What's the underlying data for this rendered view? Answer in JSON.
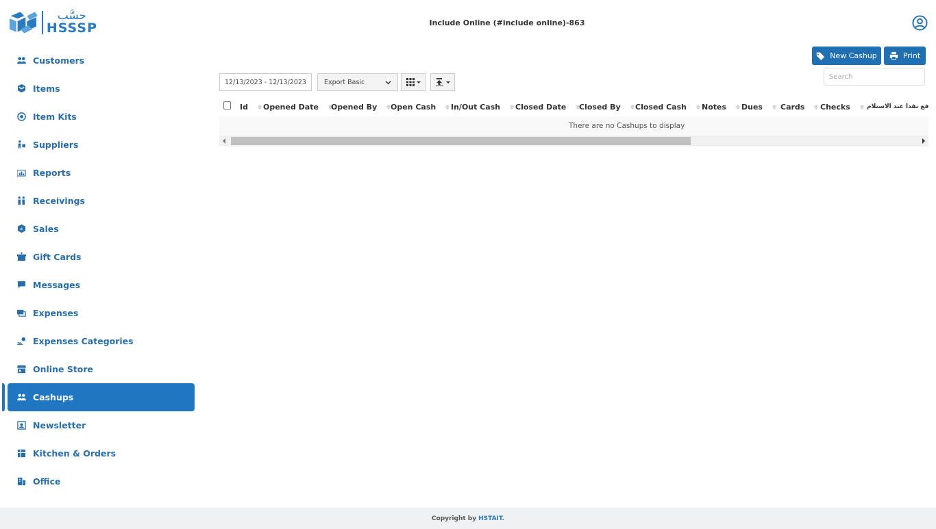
{
  "brand": {
    "arabic": "حسَّب",
    "latin": "HSSSP",
    "color": "#2a7bc0"
  },
  "header": {
    "title": "Include Online (#include online)-863"
  },
  "sidebar": {
    "items": [
      {
        "label": "Customers",
        "icon": "customers-icon"
      },
      {
        "label": "Items",
        "icon": "items-icon"
      },
      {
        "label": "Item Kits",
        "icon": "item-kits-icon"
      },
      {
        "label": "Suppliers",
        "icon": "suppliers-icon"
      },
      {
        "label": "Reports",
        "icon": "reports-icon"
      },
      {
        "label": "Receivings",
        "icon": "receivings-icon"
      },
      {
        "label": "Sales",
        "icon": "sales-icon"
      },
      {
        "label": "Gift Cards",
        "icon": "gift-cards-icon"
      },
      {
        "label": "Messages",
        "icon": "messages-icon"
      },
      {
        "label": "Expenses",
        "icon": "expenses-icon"
      },
      {
        "label": "Expenses Categories",
        "icon": "expenses-categories-icon"
      },
      {
        "label": "Online Store",
        "icon": "online-store-icon"
      },
      {
        "label": "Cashups",
        "icon": "cashups-icon",
        "active": true
      },
      {
        "label": "Newsletter",
        "icon": "newsletter-icon"
      },
      {
        "label": "Kitchen & Orders",
        "icon": "kitchen-orders-icon"
      },
      {
        "label": "Office",
        "icon": "office-icon"
      }
    ],
    "active_color": "#1f77c1"
  },
  "toolbar": {
    "new_label": "New Cashup",
    "print_label": "Print",
    "search_placeholder": "Search",
    "date_range": "12/13/2023 - 12/13/2023",
    "export_selected": "Export Basic"
  },
  "table": {
    "columns": [
      "Id",
      "Opened Date",
      "Opened By",
      "Open Cash",
      "In/Out Cash",
      "Closed Date",
      "Closed By",
      "Closed Cash",
      "Notes",
      "Dues",
      "Cards",
      "Checks",
      "الدفع نقدا عند الاستلام"
    ],
    "empty_message": "There are no Cashups to display"
  },
  "footer": {
    "prefix": "Copyright by",
    "brand": "HSTAIT."
  }
}
